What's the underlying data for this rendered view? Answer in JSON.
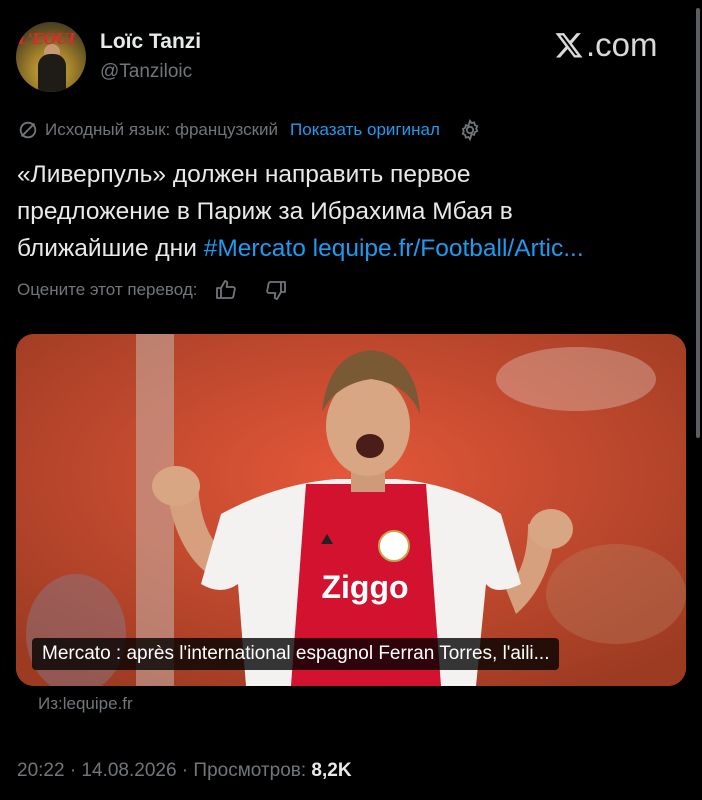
{
  "author": {
    "display_name": "Loïc Tanzi",
    "handle": "@Tanziloic",
    "avatar_text": "L'EQUI"
  },
  "brand": {
    "label": ".com",
    "icon": "x-logo-icon"
  },
  "translation": {
    "source_label": "Исходный язык: французский",
    "show_original": "Показать оригинал",
    "icon": "translate-icon",
    "settings_icon": "gear-icon"
  },
  "tweet": {
    "text_line1": "«Ливерпуль» должен направить первое",
    "text_line2": "предложение в Париж за Ибрахима Мбая в",
    "text_line3_plain": "ближайшие дни ",
    "hashtag": "#Mercato",
    "link": "lequipe.fr/Football/Artic..."
  },
  "rating": {
    "label": "Оцените этот перевод:",
    "up_icon": "thumb-up-icon",
    "down_icon": "thumb-down-icon"
  },
  "card": {
    "caption": "Mercato : après l'international espagnol Ferran Torres, l'aili...",
    "shirt_sponsor": "Ziggo"
  },
  "source": {
    "label": "Из:lequipe.fr"
  },
  "meta": {
    "timestamp": "20:22 · 14.08.2026 · ",
    "views_label": "Просмотров: ",
    "views_count": "8,2K"
  }
}
